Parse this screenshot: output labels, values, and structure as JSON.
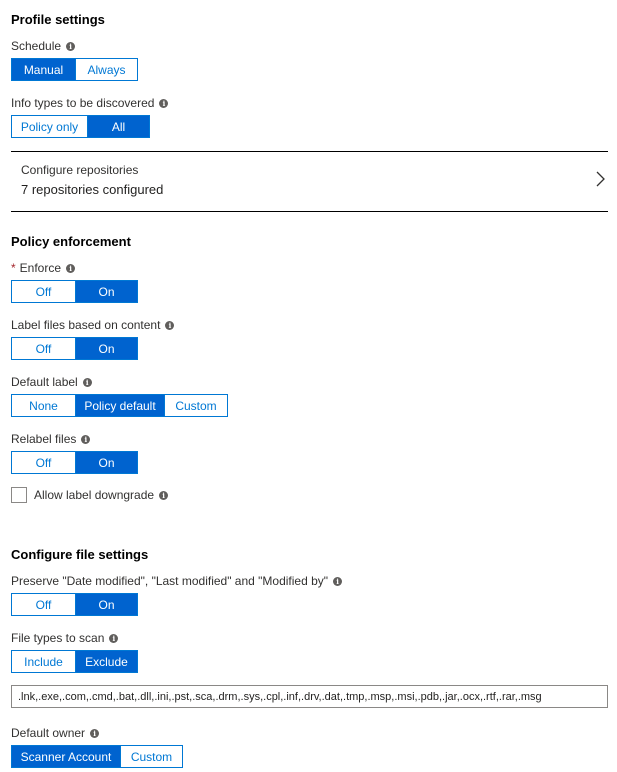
{
  "profile": {
    "heading": "Profile settings",
    "schedule": {
      "label": "Schedule",
      "options": [
        "Manual",
        "Always"
      ],
      "selected": "Manual"
    },
    "info_types": {
      "label": "Info types to be discovered",
      "options": [
        "Policy only",
        "All"
      ],
      "selected": "All"
    },
    "repositories": {
      "title": "Configure repositories",
      "status": "7 repositories configured"
    }
  },
  "policy": {
    "heading": "Policy enforcement",
    "enforce": {
      "required_mark": "*",
      "label": "Enforce",
      "options": [
        "Off",
        "On"
      ],
      "selected": "On"
    },
    "label_files": {
      "label": "Label files based on content",
      "options": [
        "Off",
        "On"
      ],
      "selected": "On"
    },
    "default_label": {
      "label": "Default label",
      "options": [
        "None",
        "Policy default",
        "Custom"
      ],
      "selected": "Policy default"
    },
    "relabel": {
      "label": "Relabel files",
      "options": [
        "Off",
        "On"
      ],
      "selected": "On"
    },
    "downgrade": {
      "label": "Allow label downgrade",
      "checked": false
    }
  },
  "file_settings": {
    "heading": "Configure file settings",
    "preserve": {
      "label": "Preserve \"Date modified\", \"Last modified\" and \"Modified by\"",
      "options": [
        "Off",
        "On"
      ],
      "selected": "On"
    },
    "file_types": {
      "label": "File types to scan",
      "options": [
        "Include",
        "Exclude"
      ],
      "selected": "Exclude"
    },
    "extensions": ".lnk,.exe,.com,.cmd,.bat,.dll,.ini,.pst,.sca,.drm,.sys,.cpl,.inf,.drv,.dat,.tmp,.msp,.msi,.pdb,.jar,.ocx,.rtf,.rar,.msg",
    "default_owner": {
      "label": "Default owner",
      "options": [
        "Scanner Account",
        "Custom"
      ],
      "selected": "Scanner Account"
    }
  },
  "info_glyph": "i"
}
